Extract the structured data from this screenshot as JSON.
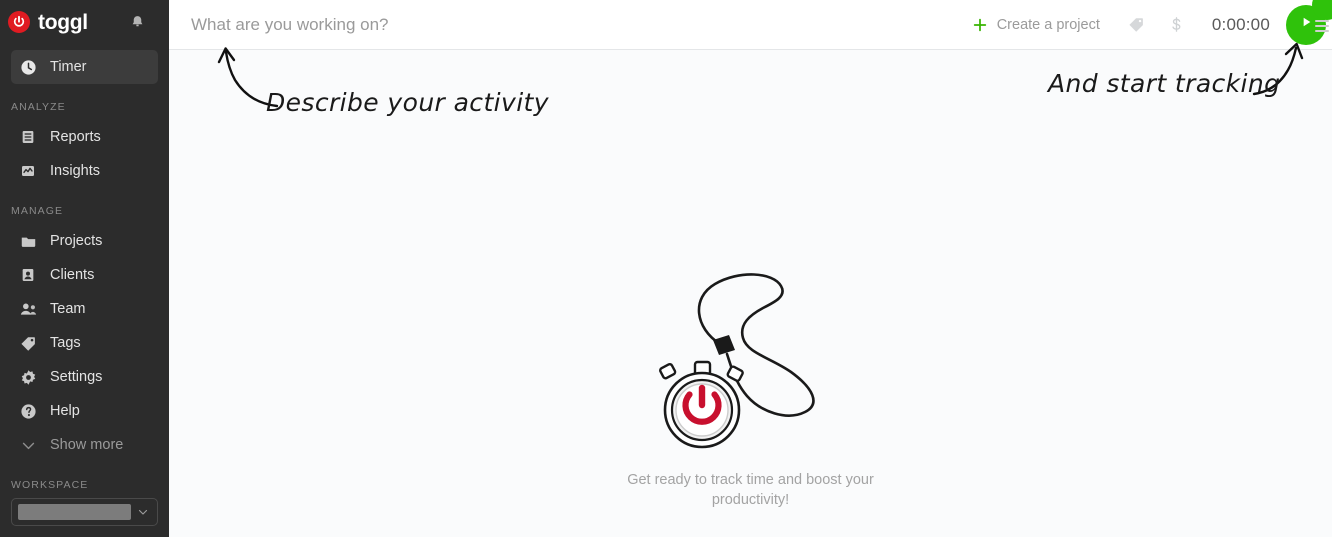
{
  "sidebar": {
    "brand": {
      "name": "toggl",
      "logo_icon": "toggl-power-logo",
      "color": "#e01b22"
    },
    "notifications_icon": "bell-icon",
    "primary": [
      {
        "label": "Timer",
        "icon": "clock-icon",
        "active": true
      }
    ],
    "sections": [
      {
        "title": "ANALYZE",
        "items": [
          {
            "label": "Reports",
            "icon": "report-document-icon"
          },
          {
            "label": "Insights",
            "icon": "insights-chart-icon"
          }
        ]
      },
      {
        "title": "MANAGE",
        "items": [
          {
            "label": "Projects",
            "icon": "folder-icon"
          },
          {
            "label": "Clients",
            "icon": "person-card-icon"
          },
          {
            "label": "Team",
            "icon": "people-icon"
          },
          {
            "label": "Tags",
            "icon": "tag-icon"
          },
          {
            "label": "Settings",
            "icon": "gear-icon"
          },
          {
            "label": "Help",
            "icon": "question-circle-icon"
          },
          {
            "label": "Show more",
            "icon": "chevron-down-icon",
            "muted": true
          }
        ]
      }
    ],
    "workspace": {
      "title": "WORKSPACE",
      "value": "",
      "loading": true,
      "caret_icon": "chevron-down-icon"
    }
  },
  "topbar": {
    "task_input": {
      "value": "",
      "placeholder": "What are you working on?"
    },
    "create_project": {
      "label": "Create a project",
      "icon": "plus-icon",
      "color": "#37b400"
    },
    "tag_button_icon": "tag-icon",
    "billable_button_icon": "dollar-icon",
    "timer_readout": "0:00:00",
    "start_button": {
      "icon": "play-icon",
      "color": "#2fc20b"
    },
    "corner_menu_icon": "list-menu-icon"
  },
  "annotations": {
    "left": {
      "text": "Describe your activity",
      "arrow": "curved-arrow-up-left"
    },
    "right": {
      "text": "And start tracking",
      "arrow": "curved-arrow-up-right"
    }
  },
  "empty_state": {
    "illustration_icon": "stopwatch-with-lanyard-illustration",
    "caption": "Get ready to track time and boost your productivity!"
  }
}
